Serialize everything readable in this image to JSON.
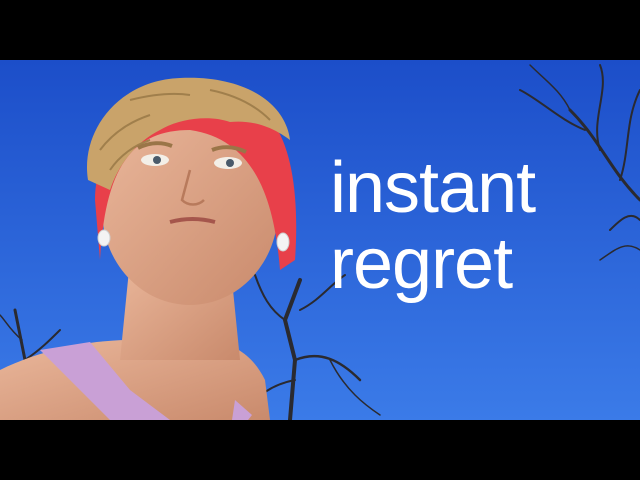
{
  "caption": {
    "line1": "instant",
    "line2": "regret"
  },
  "colors": {
    "sky_top": "#1c4ec9",
    "sky_bottom": "#3b7be8",
    "headband": "#e8404a",
    "hair": "#c9a36a",
    "skin": "#e2a98a",
    "tank_top": "#c9a0d6",
    "branches": "#2a2a30",
    "caption_text": "#ffffff",
    "letterbox": "#000000"
  },
  "icons": {
    "earbuds": "earbud-icon"
  }
}
